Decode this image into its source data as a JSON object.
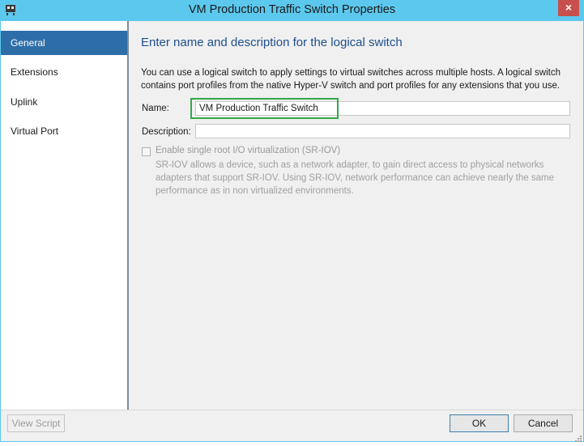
{
  "window": {
    "title": "VM Production Traffic Switch Properties",
    "close_glyph": "×",
    "accent_color": "#5cc8ee"
  },
  "sidebar": {
    "items": [
      {
        "label": "General",
        "active": true
      },
      {
        "label": "Extensions",
        "active": false
      },
      {
        "label": "Uplink",
        "active": false
      },
      {
        "label": "Virtual Port",
        "active": false
      }
    ]
  },
  "main": {
    "heading": "Enter name and description for the logical switch",
    "description": "You can use a logical switch to apply settings to virtual switches across multiple hosts. A logical switch contains port profiles from the native Hyper-V switch and port profiles for any extensions that you use.",
    "name_label": "Name:",
    "name_value": "VM Production Traffic Switch",
    "description_label": "Description:",
    "description_value": "",
    "sriov_label": "Enable single root I/O virtualization (SR-IOV)",
    "sriov_checked": false,
    "sriov_help": "SR-IOV allows a device, such as a network adapter, to gain direct access to physical networks adapters that support SR-IOV. Using SR-IOV, network performance can achieve nearly the same performance as in non virtualized environments."
  },
  "footer": {
    "view_script_label": "View Script",
    "ok_label": "OK",
    "cancel_label": "Cancel"
  },
  "icons": {
    "app": "scvmm-app-icon",
    "close": "close-icon",
    "grip": "resize-grip-icon"
  }
}
